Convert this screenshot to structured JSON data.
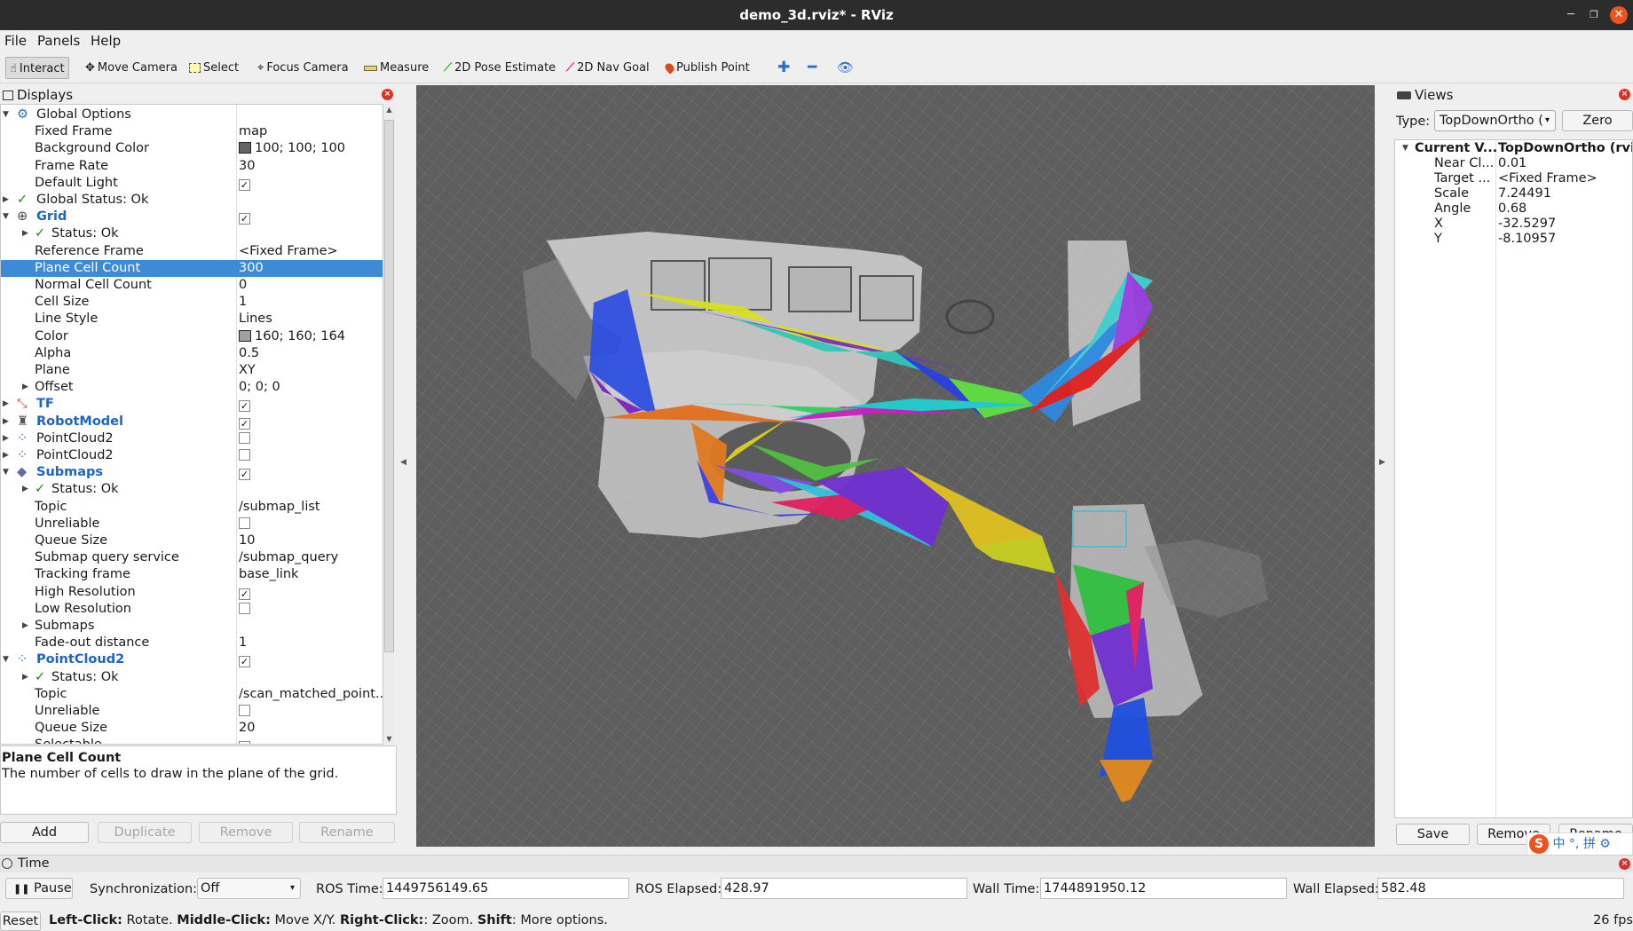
{
  "window": {
    "title": "demo_3d.rviz* - RViz"
  },
  "menu": [
    "File",
    "Panels",
    "Help"
  ],
  "toolbar": [
    "Interact",
    "Move Camera",
    "Select",
    "Focus Camera",
    "Measure",
    "2D Pose Estimate",
    "2D Nav Goal",
    "Publish Point"
  ],
  "displays": {
    "title": "Displays",
    "rows": [
      {
        "name": "Global Options",
        "value": ""
      },
      {
        "name": "Fixed Frame",
        "value": "map"
      },
      {
        "name": "Background Color",
        "value": "100; 100; 100"
      },
      {
        "name": "Frame Rate",
        "value": "30"
      },
      {
        "name": "Default Light",
        "value": ""
      },
      {
        "name": "Global Status: Ok",
        "value": ""
      },
      {
        "name": "Grid",
        "value": ""
      },
      {
        "name": "Status: Ok",
        "value": ""
      },
      {
        "name": "Reference Frame",
        "value": "<Fixed Frame>"
      },
      {
        "name": "Plane Cell Count",
        "value": "300"
      },
      {
        "name": "Normal Cell Count",
        "value": "0"
      },
      {
        "name": "Cell Size",
        "value": "1"
      },
      {
        "name": "Line Style",
        "value": "Lines"
      },
      {
        "name": "Color",
        "value": "160; 160; 164"
      },
      {
        "name": "Alpha",
        "value": "0.5"
      },
      {
        "name": "Plane",
        "value": "XY"
      },
      {
        "name": "Offset",
        "value": "0; 0; 0"
      },
      {
        "name": "TF",
        "value": ""
      },
      {
        "name": "RobotModel",
        "value": ""
      },
      {
        "name": "PointCloud2",
        "value": ""
      },
      {
        "name": "PointCloud2",
        "value": ""
      },
      {
        "name": "Submaps",
        "value": ""
      },
      {
        "name": "Status: Ok",
        "value": ""
      },
      {
        "name": "Topic",
        "value": "/submap_list"
      },
      {
        "name": "Unreliable",
        "value": ""
      },
      {
        "name": "Queue Size",
        "value": "10"
      },
      {
        "name": "Submap query service",
        "value": "/submap_query"
      },
      {
        "name": "Tracking frame",
        "value": "base_link"
      },
      {
        "name": "High Resolution",
        "value": ""
      },
      {
        "name": "Low Resolution",
        "value": ""
      },
      {
        "name": "Submaps",
        "value": ""
      },
      {
        "name": "Fade-out distance",
        "value": "1"
      },
      {
        "name": "PointCloud2",
        "value": ""
      },
      {
        "name": "Status: Ok",
        "value": ""
      },
      {
        "name": "Topic",
        "value": "/scan_matched_point..."
      },
      {
        "name": "Unreliable",
        "value": ""
      },
      {
        "name": "Queue Size",
        "value": "20"
      },
      {
        "name": "Selectable",
        "value": ""
      }
    ],
    "checks": {
      "4": true,
      "6": true,
      "17": true,
      "18": true,
      "19": false,
      "20": false,
      "21": true,
      "24": false,
      "28": true,
      "29": false,
      "32": true,
      "35": false,
      "37": true
    },
    "selected_index": 9,
    "colors": {
      "background": "#646464",
      "grid": "#a0a0a4",
      "selection": "#3d8ad6",
      "link": "#1c66c9"
    },
    "description": {
      "title": "Plane Cell Count",
      "text": "The number of cells to draw in the plane of the grid."
    },
    "buttons": {
      "add": "Add",
      "duplicate": "Duplicate",
      "remove": "Remove",
      "rename": "Rename"
    }
  },
  "views": {
    "title": "Views",
    "type_label": "Type:",
    "type_value": "TopDownOrtho (",
    "zero": "Zero",
    "rows": [
      {
        "k": "Current V...",
        "v": "TopDownOrtho (rviz)"
      },
      {
        "k": "Near Cl...",
        "v": "0.01"
      },
      {
        "k": "Target ...",
        "v": "<Fixed Frame>"
      },
      {
        "k": "Scale",
        "v": "7.24491"
      },
      {
        "k": "Angle",
        "v": "0.68"
      },
      {
        "k": "X",
        "v": "-32.5297"
      },
      {
        "k": "Y",
        "v": "-8.10957"
      }
    ],
    "buttons": {
      "save": "Save",
      "remove": "Remove",
      "rename": "Rename"
    }
  },
  "time": {
    "title": "Time",
    "pause": "Pause",
    "sync_label": "Synchronization:",
    "sync_value": "Off",
    "ros_time_label": "ROS Time:",
    "ros_time": "1449756149.65",
    "ros_elapsed_label": "ROS Elapsed:",
    "ros_elapsed": "428.97",
    "wall_time_label": "Wall Time:",
    "wall_time": "1744891950.12",
    "wall_elapsed_label": "Wall Elapsed:",
    "wall_elapsed": "582.48"
  },
  "status": {
    "reset": "Reset",
    "hints": [
      {
        "k": "Left-Click:",
        "t": " Rotate. "
      },
      {
        "k": "Middle-Click:",
        "t": " Move X/Y. "
      },
      {
        "k": "Right-Click:",
        "t": ": Zoom. "
      },
      {
        "k": "Shift",
        "t": ": More options."
      }
    ],
    "fps": "26 fps"
  },
  "ime": {
    "chars": [
      "中",
      "°,",
      "拼"
    ]
  }
}
